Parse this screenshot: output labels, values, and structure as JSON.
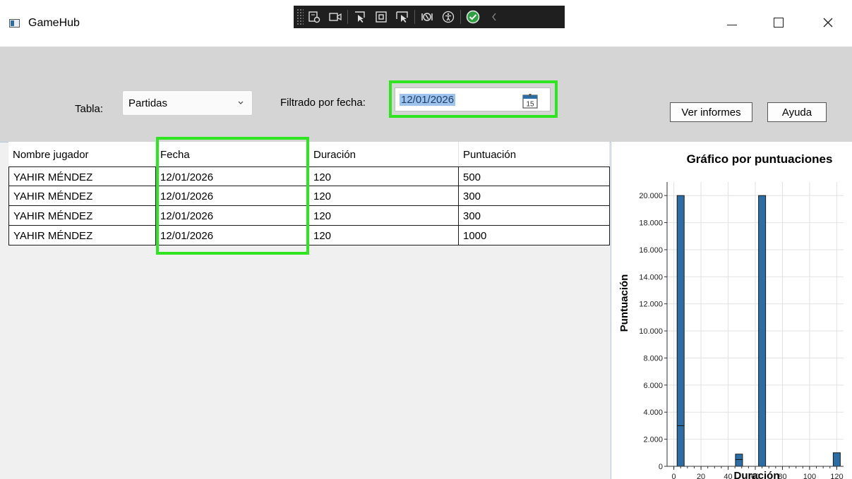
{
  "window": {
    "title": "GameHub"
  },
  "toolbar": {
    "tabla_label": "Tabla:",
    "tabla_selected": "Partidas",
    "filtro_label": "Filtrado por fecha:",
    "filtro_value": "12/01/2026",
    "calendar_day": "15",
    "ver_informes": "Ver informes",
    "ayuda": "Ayuda"
  },
  "table": {
    "headers": [
      "Nombre jugador",
      "Fecha",
      "Duración",
      "Puntuación"
    ],
    "rows": [
      [
        "YAHIR MÉNDEZ",
        "12/01/2026",
        "120",
        "500"
      ],
      [
        "YAHIR MÉNDEZ",
        "12/01/2026",
        "120",
        "300"
      ],
      [
        "YAHIR MÉNDEZ",
        "12/01/2026",
        "120",
        "300"
      ],
      [
        "YAHIR MÉNDEZ",
        "12/01/2026",
        "120",
        "1000"
      ]
    ]
  },
  "colors": {
    "highlight": "#2ee51f",
    "bar": "#2b6ea6",
    "selection": "#9fc4ec"
  },
  "chart_data": {
    "type": "bar",
    "title": "Gráfico por puntuaciones",
    "xlabel": "Duración",
    "ylabel": "Puntuación",
    "xlim": [
      -5,
      125
    ],
    "ylim": [
      0,
      21000
    ],
    "xticks": [
      0,
      20,
      40,
      60,
      80,
      100,
      120
    ],
    "yticks": [
      0,
      2000,
      4000,
      6000,
      8000,
      10000,
      12000,
      14000,
      16000,
      18000,
      20000
    ],
    "ytick_labels": [
      "0",
      "2.000",
      "4.000",
      "6.000",
      "8.000",
      "10.000",
      "12.000",
      "14.000",
      "16.000",
      "18.000",
      "20.000"
    ],
    "grid": true,
    "bars": [
      {
        "x": 5,
        "value": 20000,
        "inner_line": 3000
      },
      {
        "x": 48,
        "value": 900,
        "inner_line": 500
      },
      {
        "x": 65,
        "value": 20000
      },
      {
        "x": 120,
        "value": 1000
      }
    ]
  }
}
